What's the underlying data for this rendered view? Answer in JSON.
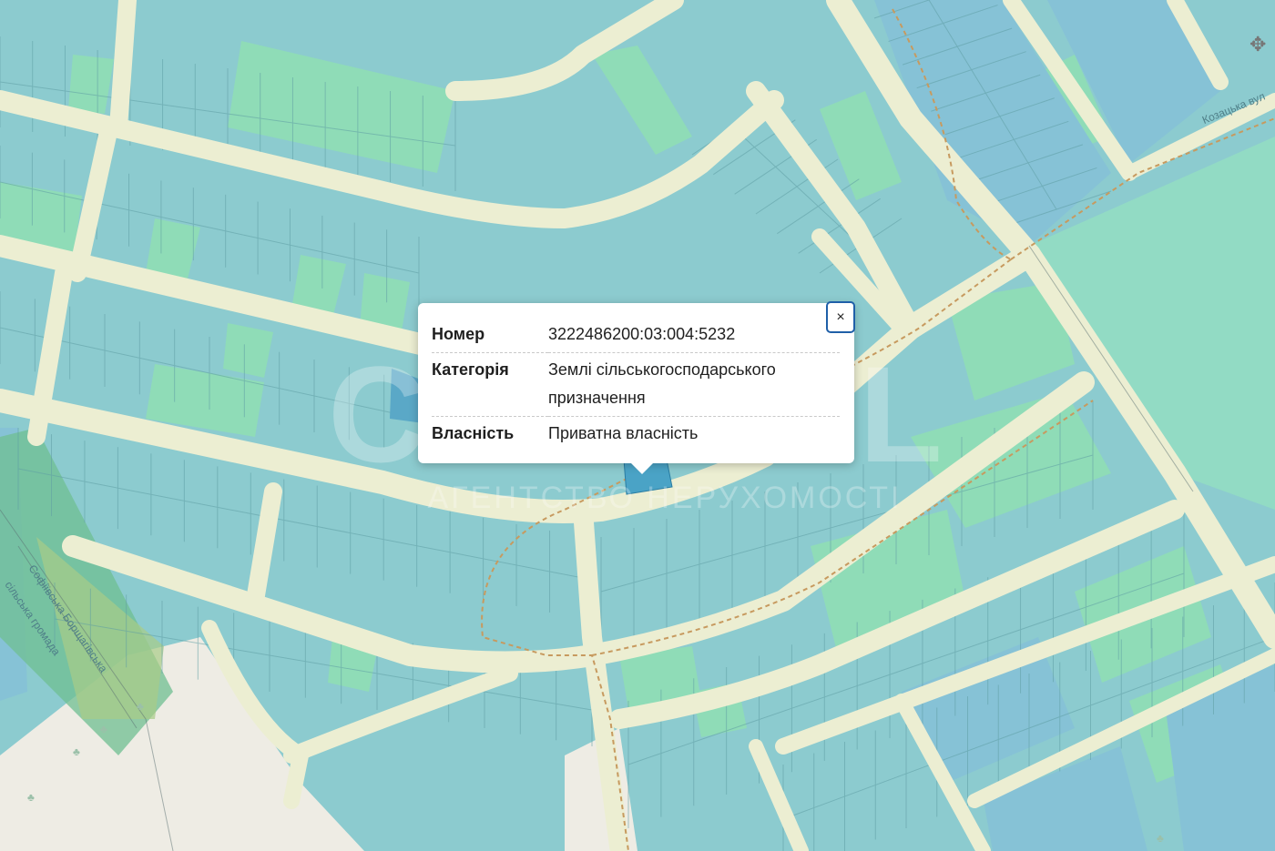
{
  "popup": {
    "close_label": "×",
    "fields": [
      {
        "key": "Номер",
        "value": "3222486200:03:004:5232"
      },
      {
        "key": "Категорія",
        "value": "Землі сільськогосподарського призначення"
      },
      {
        "key": "Власність",
        "value": "Приватна власність"
      }
    ]
  },
  "watermark": {
    "title": "CAPITAL",
    "subtitle": "АГЕНТСТВО НЕРУХОМОСТІ"
  },
  "labels": {
    "street_top_right": "Козацька вул",
    "boundary_1": "Софіївська Борщагівська",
    "boundary_2": "сільська громада"
  },
  "colors": {
    "parcel_teal": "#8ccbcf",
    "parcel_green": "#8fdcb7",
    "parcel_blue": "#86c2d6",
    "road": "#eceed2",
    "selected": "#4aa3c6",
    "boundary": "#5eb08a"
  }
}
